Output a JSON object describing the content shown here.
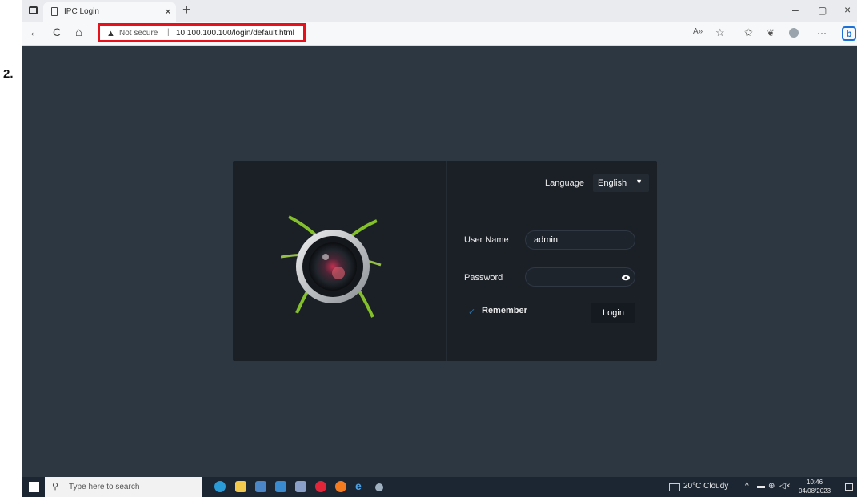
{
  "annotation": {
    "step_label": "2."
  },
  "browser": {
    "tab_title": "IPC Login",
    "tab_close": "×",
    "new_tab": "+",
    "minimize": "–",
    "maximize": "▢",
    "close": "×",
    "back": "←",
    "refresh": "C",
    "home": "⌂",
    "not_secure": "Not secure",
    "separator": "|",
    "url": "10.100.100.100/login/default.html",
    "read_aloud": "A»",
    "favorite": "☆",
    "favorites": "✩",
    "more": "···",
    "copilot": "b"
  },
  "login": {
    "language_label": "Language",
    "language_value": "English",
    "username_label": "User Name",
    "username_value": "admin",
    "password_label": "Password",
    "password_value": "",
    "remember_label": "Remember",
    "login_button": "Login"
  },
  "taskbar": {
    "search_placeholder": "Type here to search",
    "weather": "20°C Cloudy",
    "time": "10:46",
    "date": "04/08/2023"
  },
  "colors": {
    "page_background": "#2d3741",
    "card_background": "#1b2027",
    "highlight_box": "#e8101b"
  }
}
